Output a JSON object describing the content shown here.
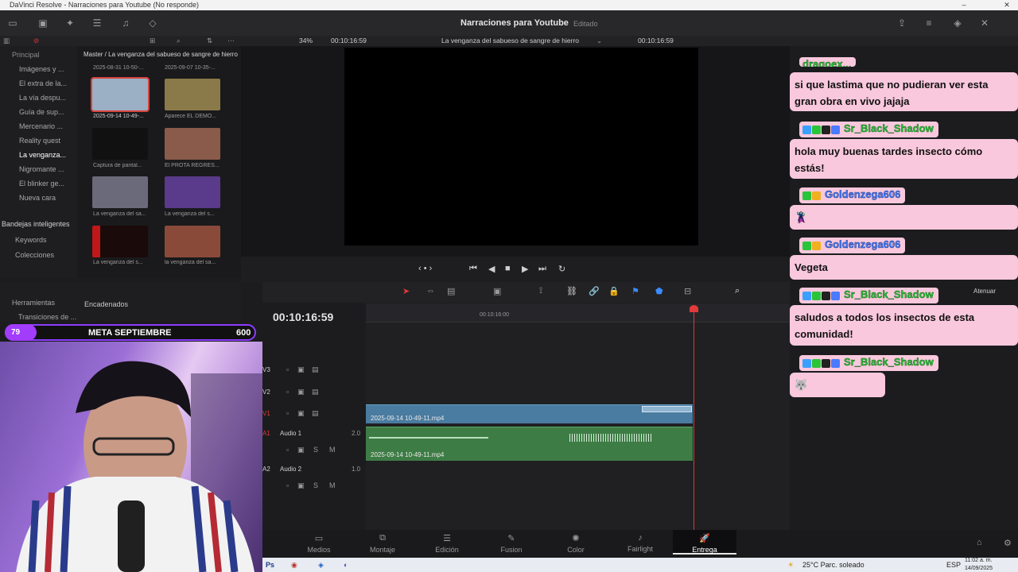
{
  "window": {
    "title": "DaVinci Resolve - Narraciones para Youtube (No responde)",
    "minimize_glyph": "–",
    "close_glyph": "✕"
  },
  "project": {
    "name": "Narraciones para Youtube",
    "status": "Editado"
  },
  "viewer_bar": {
    "zoom": "34%",
    "source_timecode": "00:10:16:59",
    "timeline_name": "La venganza del sabueso de sangre de hierro",
    "record_timecode": "00:10:16:59"
  },
  "sidebar": {
    "header": "Principal",
    "items": [
      {
        "label": "Imágenes y ...",
        "selected": false
      },
      {
        "label": "El extra de la...",
        "selected": false
      },
      {
        "label": "La vía despu...",
        "selected": false
      },
      {
        "label": "Guía de sup...",
        "selected": false
      },
      {
        "label": "Mercenario ...",
        "selected": false
      },
      {
        "label": "Reality quest",
        "selected": false
      },
      {
        "label": "La venganza...",
        "selected": true
      },
      {
        "label": "Nigromante ...",
        "selected": false
      },
      {
        "label": "El blinker ge...",
        "selected": false
      },
      {
        "label": "Nueva cara",
        "selected": false
      }
    ],
    "smart_bins_header": "Bandejas inteligentes",
    "smart_bins": [
      "Keywords",
      "Colecciones"
    ]
  },
  "media_pool": {
    "path": "Master / La venganza del sabueso de sangre de hierro",
    "top_labels": [
      "2025-08-31 10-50-...",
      "2025-09-07 10-35-..."
    ],
    "clips": [
      {
        "label": "2025-09-14 10-49-...",
        "color": "#9bb0c4",
        "selected": true
      },
      {
        "label": "Aparece EL DEMO...",
        "color": "#8a7a4a",
        "selected": false
      },
      {
        "label": "Captura de pantal...",
        "color": "#111111",
        "selected": false
      },
      {
        "label": "El PROTA REGRES...",
        "color": "#8a5a4a",
        "selected": false
      },
      {
        "label": "La venganza del sa...",
        "color": "#6a6a7a",
        "selected": false
      },
      {
        "label": "La venganza del s...",
        "color": "#5a3a8a",
        "selected": false
      },
      {
        "label": "La venganza del s...",
        "color": "#1a0a0a",
        "selected": false
      },
      {
        "label": "la venganza del sa...",
        "color": "#8a4a3a",
        "selected": false
      }
    ]
  },
  "lower_left": {
    "tools_header": "Herramientas",
    "tools_item": "Transiciones de ...",
    "tools_item2": "...iciones de ...",
    "chained_header": "Encadenados"
  },
  "timeline": {
    "timecode": "00:10:16:59",
    "ruler_mark": "00:10:16:00",
    "attenuate_label": "Atenuar",
    "tracks": [
      {
        "id": "V3",
        "name": ""
      },
      {
        "id": "V2",
        "name": ""
      },
      {
        "id": "V1",
        "name": ""
      },
      {
        "id": "A1",
        "name": "Audio 1",
        "level": "2.0"
      },
      {
        "id": "A2",
        "name": "Audio 2",
        "level": "1.0"
      }
    ],
    "video_clip_name": "2025-09-14 10-49-11.mp4",
    "audio_clip_name": "2025-09-14 10-49-11.mp4",
    "mute_label": "M",
    "solo_label": "S"
  },
  "pages": [
    {
      "label": "Medios",
      "icon": "media-icon",
      "active": false
    },
    {
      "label": "Montaje",
      "icon": "cut-icon",
      "active": false
    },
    {
      "label": "Edición",
      "icon": "edit-icon",
      "active": false
    },
    {
      "label": "Fusion",
      "icon": "fusion-icon",
      "active": false
    },
    {
      "label": "Color",
      "icon": "color-icon",
      "active": false
    },
    {
      "label": "Fairlight",
      "icon": "fairlight-icon",
      "active": false
    },
    {
      "label": "Entrega",
      "icon": "deliver-icon",
      "active": true
    }
  ],
  "taskbar": {
    "weather": "25°C  Parc. soleado",
    "language": "ESP",
    "time": "11:02 a. m.",
    "date": "14/09/2025",
    "app_ps": "Ps"
  },
  "stream_goal": {
    "current": "79",
    "title": "META SEPTIEMBRE",
    "goal": "600"
  },
  "chat": [
    {
      "user": "dragoex...",
      "text": "si que lastima que no pudieran ver esta gran obra en vivo jajaja",
      "color": "#2ac43a"
    },
    {
      "user": "Sr_Black_Shadow",
      "text": "hola muy buenas tardes insecto cómo estás!",
      "color": "#2ac43a"
    },
    {
      "user": "Goldenzega606",
      "text": "🦹",
      "color": "#4a82ff"
    },
    {
      "user": "Goldenzega606",
      "text": "Vegeta",
      "color": "#4a82ff"
    },
    {
      "user": "Sr_Black_Shadow",
      "text": "saludos a todos los insectos de esta comunidad!",
      "color": "#2ac43a"
    },
    {
      "user": "Sr_Black_Shadow",
      "text": "🐺",
      "color": "#2ac43a"
    }
  ],
  "colors": {
    "accent_red": "#e03a3a",
    "video_clip": "#4a7ba0",
    "audio_clip": "#3e7c46",
    "chat_bg": "#f9c8dc",
    "goal_purple": "#a23cff"
  }
}
